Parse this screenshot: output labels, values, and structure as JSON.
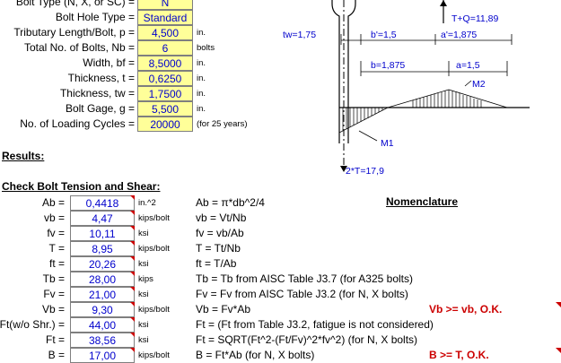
{
  "inputs": [
    {
      "label": "Bolt Type (N, X, or SC) =",
      "value": "N",
      "unit": ""
    },
    {
      "label": "Bolt Hole Type =",
      "value": "Standard",
      "unit": ""
    },
    {
      "label": "Tributary Length/Bolt, p =",
      "value": "4,500",
      "unit": "in."
    },
    {
      "label": "Total No. of Bolts, Nb =",
      "value": "6",
      "unit": "bolts"
    },
    {
      "label": "Width, bf =",
      "value": "8,5000",
      "unit": "in."
    },
    {
      "label": "Thickness, t =",
      "value": "0,6250",
      "unit": "in."
    },
    {
      "label": "Thickness, tw =",
      "value": "1,7500",
      "unit": "in."
    },
    {
      "label": "Bolt Gage, g =",
      "value": "5,500",
      "unit": "in."
    },
    {
      "label": "No. of Loading Cycles =",
      "value": "20000",
      "unit": "(for 25 years)"
    }
  ],
  "results_heading": "Results:",
  "check_heading": "Check Bolt Tension and Shear:",
  "nomenclature": "Nomenclature",
  "results": [
    {
      "label": "Ab =",
      "value": "0,4418",
      "unit": "in.^2",
      "formula": "Ab = π*db^2/4"
    },
    {
      "label": "vb =",
      "value": "4,47",
      "unit": "kips/bolt",
      "formula": "vb = Vt/Nb"
    },
    {
      "label": "fv =",
      "value": "10,11",
      "unit": "ksi",
      "formula": "fv = vb/Ab"
    },
    {
      "label": "T =",
      "value": "8,95",
      "unit": "kips/bolt",
      "formula": "T = Tt/Nb"
    },
    {
      "label": "ft =",
      "value": "20,26",
      "unit": "ksi",
      "formula": "ft = T/Ab"
    },
    {
      "label": "Tb =",
      "value": "28,00",
      "unit": "kips",
      "formula": "Tb = Tb from AISC Table J3.7  (for A325 bolts)"
    },
    {
      "label": "Fv =",
      "value": "21,00",
      "unit": "ksi",
      "formula": "Fv  = Fv from AISC Table J3.2  (for N, X bolts)"
    },
    {
      "label": "Vb =",
      "value": "9,30",
      "unit": "kips/bolt",
      "formula": "Vb = Fv*Ab"
    },
    {
      "label": "Ft(w/o Shr.) =",
      "value": "44,00",
      "unit": "ksi",
      "formula": "Ft = (Ft from Table J3.2, fatigue is not considered)"
    },
    {
      "label": "Ft =",
      "value": "38,56",
      "unit": "ksi",
      "formula": "Ft = SQRT(Ft^2-(Ft/Fv)^2*fv^2)  (for N, X bolts)"
    },
    {
      "label": "B =",
      "value": "17,00",
      "unit": "kips/bolt",
      "formula": "B = Ft*Ab  (for N, X bolts)"
    }
  ],
  "checks": {
    "shear": "Vb >= vb, O.K.",
    "tension": "B >= T,  O.K."
  },
  "diagram": {
    "tw": "tw=1,75",
    "b_prime": "b'=1,5",
    "a_prime": "a'=1,875",
    "b": "b=1,875",
    "a": "a=1,5",
    "tq": "T+Q=11,89",
    "m2": "M2",
    "m1": "M1",
    "two_t": "2*T=17,9"
  }
}
